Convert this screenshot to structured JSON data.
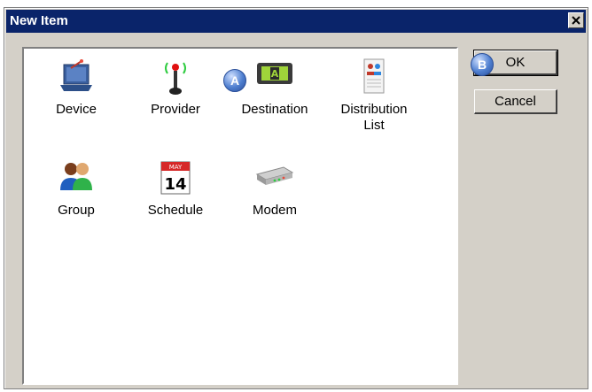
{
  "dialog": {
    "title": "New Item",
    "close_icon": "close-icon"
  },
  "items": [
    {
      "label": "Device",
      "icon": "device-laptop-icon"
    },
    {
      "label": "Provider",
      "icon": "provider-antenna-icon"
    },
    {
      "label": "Destination",
      "icon": "destination-pager-icon"
    },
    {
      "label": "Distribution\nList",
      "icon": "distribution-list-icon"
    },
    {
      "label": "Group",
      "icon": "group-users-icon"
    },
    {
      "label": "Schedule",
      "icon": "schedule-calendar-icon",
      "calendar_month": "MAY",
      "calendar_day": "14"
    },
    {
      "label": "Modem",
      "icon": "modem-icon"
    }
  ],
  "buttons": {
    "ok_label": "OK",
    "cancel_label": "Cancel"
  },
  "callouts": {
    "a": "A",
    "b": "B"
  },
  "colors": {
    "titlebar": "#0a246a",
    "dialog_bg": "#d4d0c8",
    "callout": "#4f7fd0"
  }
}
